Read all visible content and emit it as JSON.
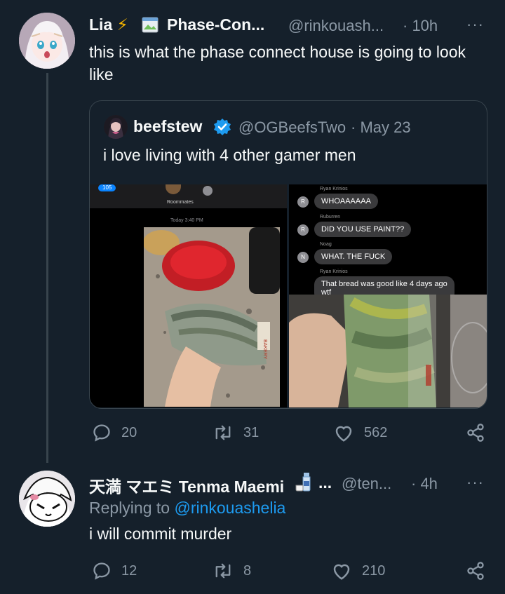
{
  "tweet": {
    "display_name": "Lia",
    "emoji": "⚡",
    "name_suffix": "Phase-Con...",
    "handle": "@rinkouash...",
    "time": "· 10h",
    "text": "this is what the phase connect house is going to look like",
    "more": "···"
  },
  "quoted": {
    "display_name": "beefstew",
    "handle": "@OGBeefsTwo",
    "date": "· May 23",
    "text": "i love living with 4 other gamer men",
    "image1": {
      "back_count": "105",
      "title": "Roommates",
      "timestamp": "Today 3:40 PM"
    },
    "image2": {
      "messages": [
        {
          "sender": "Ryan Krinios",
          "initial": "R",
          "text": "WHOAAAAAA"
        },
        {
          "sender": "Ruburren",
          "initial": "R",
          "text": "DID YOU USE PAINT??"
        },
        {
          "sender": "Noag",
          "initial": "N",
          "text": "WHAT. THE FUCK"
        },
        {
          "sender": "Ryan Krinios",
          "initial": "",
          "text": "That bread was good like 4 days ago"
        }
      ],
      "overflow_text": "wtf"
    },
    "bag_text": "BAKERY"
  },
  "actions1": {
    "replies": "20",
    "retweets": "31",
    "likes": "562"
  },
  "reply": {
    "display_name": "天満 マエミ Tenma Maemi",
    "name_suffix": "...",
    "handle": "@ten...",
    "time": "· 4h",
    "replying_prefix": "Replying to",
    "replying_handle": "@rinkouashelia",
    "text": "i will commit murder",
    "more": "···"
  },
  "actions2": {
    "replies": "12",
    "retweets": "8",
    "likes": "210"
  },
  "colors": {
    "background": "#15202b",
    "text": "#f7f9f9",
    "muted": "#8b98a5",
    "accent": "#1d9bf0",
    "border": "#38444d",
    "verified": "#1d9bf0",
    "bolt": "#f4b400"
  }
}
